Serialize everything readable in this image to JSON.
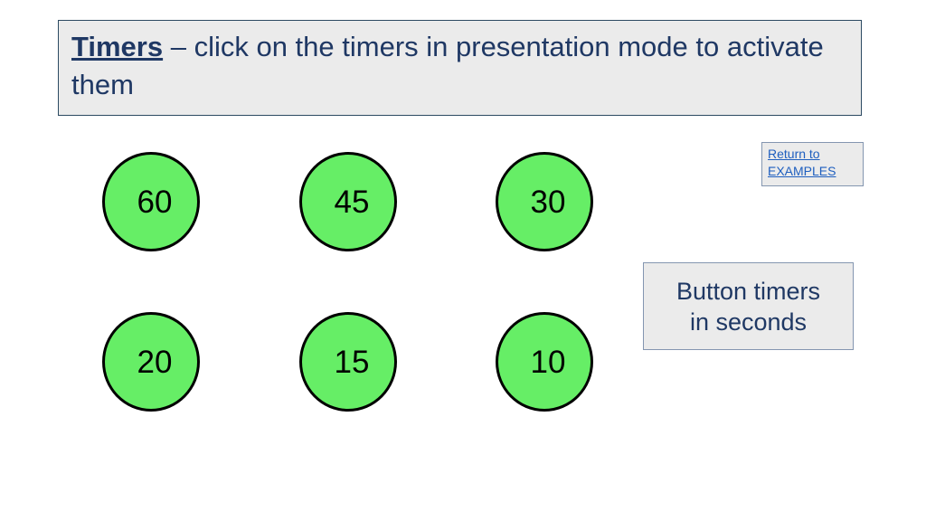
{
  "slide": {
    "background_color": "#ffffff",
    "title": {
      "emphasis": "Timers",
      "rest": " – click on the timers in presentation mode to activate them",
      "text_color": "#1f3864",
      "box_fill": "#ebebeb",
      "box_border": "#2c4a62"
    },
    "return_link": {
      "line1": "Return to",
      "line2": "EXAMPLES",
      "link_color": "#1f5fbf",
      "box_fill": "#ebebeb",
      "box_border": "#8496b0"
    },
    "caption": {
      "line1": "Button timers",
      "line2": "in seconds",
      "text_color": "#1f3864",
      "box_fill": "#ebebeb",
      "box_border": "#8496b0"
    },
    "timers": {
      "fill_color": "#66ee66",
      "border_color": "#000000",
      "label_color": "#000000",
      "unit": "seconds",
      "buttons": [
        {
          "value": "60",
          "row": 1,
          "col": 1
        },
        {
          "value": "45",
          "row": 1,
          "col": 2
        },
        {
          "value": "30",
          "row": 1,
          "col": 3
        },
        {
          "value": "20",
          "row": 2,
          "col": 1
        },
        {
          "value": "15",
          "row": 2,
          "col": 2
        },
        {
          "value": "10",
          "row": 2,
          "col": 3
        }
      ]
    }
  }
}
